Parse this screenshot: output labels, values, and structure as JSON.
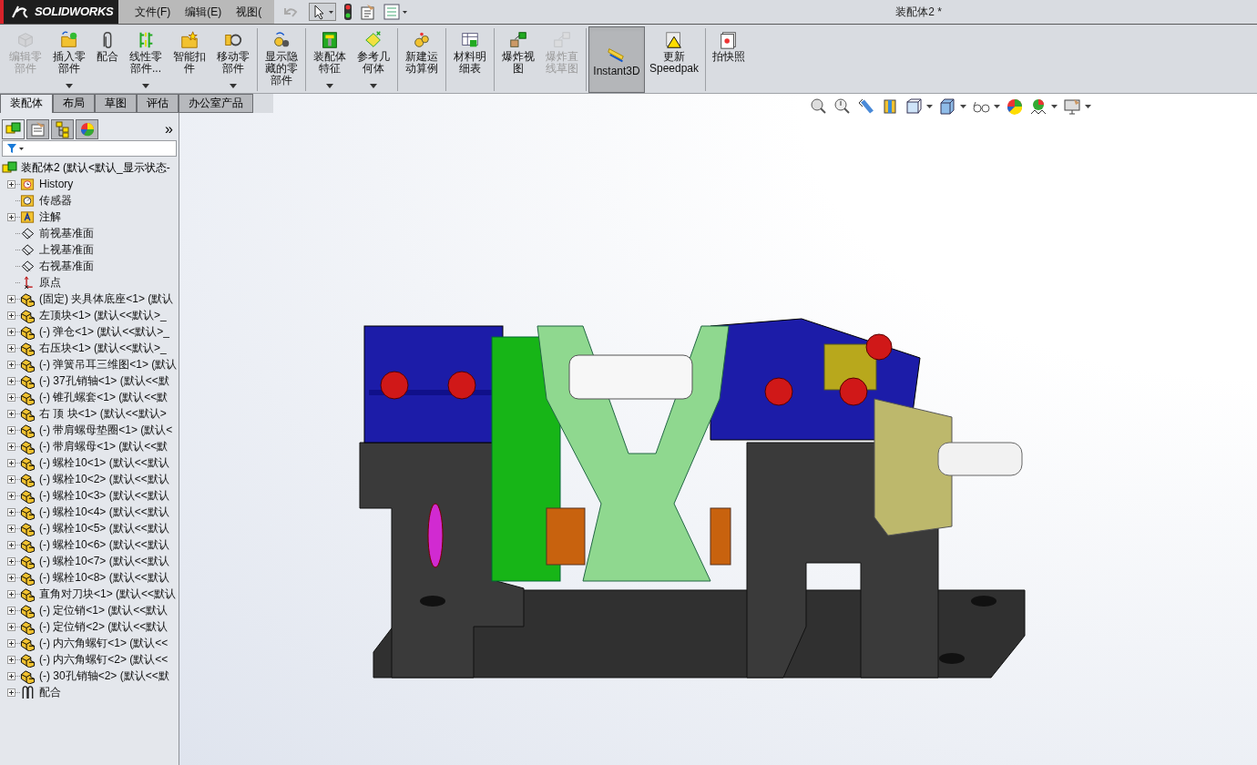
{
  "app": {
    "logo": "SOLIDWORKS"
  },
  "menu": [
    "文件(F)",
    "编辑(E)",
    "视图("
  ],
  "window": {
    "title": "装配体2 *"
  },
  "ribbon": [
    {
      "label": "编辑零部件",
      "disabled": true,
      "dropdown": false,
      "selected": false,
      "separator_after": false
    },
    {
      "label": "插入零部件",
      "disabled": false,
      "dropdown": true,
      "selected": false,
      "separator_after": false
    },
    {
      "label": "配合",
      "disabled": false,
      "dropdown": false,
      "selected": false,
      "separator_after": false
    },
    {
      "label": "线性零部件...",
      "disabled": false,
      "dropdown": true,
      "selected": false,
      "separator_after": false
    },
    {
      "label": "智能扣件",
      "disabled": false,
      "dropdown": false,
      "selected": false,
      "separator_after": false
    },
    {
      "label": "移动零部件",
      "disabled": false,
      "dropdown": true,
      "selected": false,
      "separator_after": true
    },
    {
      "label": "显示隐藏的零部件",
      "disabled": false,
      "dropdown": false,
      "selected": false,
      "separator_after": true
    },
    {
      "label": "装配体特征",
      "disabled": false,
      "dropdown": true,
      "selected": false,
      "separator_after": false
    },
    {
      "label": "参考几何体",
      "disabled": false,
      "dropdown": true,
      "selected": false,
      "separator_after": true
    },
    {
      "label": "新建运动算例",
      "disabled": false,
      "dropdown": false,
      "selected": false,
      "separator_after": true
    },
    {
      "label": "材料明细表",
      "disabled": false,
      "dropdown": false,
      "selected": false,
      "separator_after": true
    },
    {
      "label": "爆炸视图",
      "disabled": false,
      "dropdown": false,
      "selected": false,
      "separator_after": false
    },
    {
      "label": "爆炸直线草图",
      "disabled": true,
      "dropdown": false,
      "selected": false,
      "separator_after": true
    },
    {
      "label": "Instant3D",
      "disabled": false,
      "dropdown": false,
      "selected": true,
      "separator_after": false
    },
    {
      "label": "更新 Speedpak",
      "disabled": false,
      "dropdown": false,
      "selected": false,
      "separator_after": true
    },
    {
      "label": "拍快照",
      "disabled": false,
      "dropdown": false,
      "selected": false,
      "separator_after": false
    }
  ],
  "tabs": [
    {
      "label": "装配体",
      "selected": true
    },
    {
      "label": "布局",
      "selected": false
    },
    {
      "label": "草图",
      "selected": false
    },
    {
      "label": "评估",
      "selected": false
    },
    {
      "label": "办公室产品",
      "selected": false
    }
  ],
  "panel_tabs": [
    {
      "selected": true
    },
    {
      "selected": false
    },
    {
      "selected": false
    },
    {
      "selected": false
    }
  ],
  "panel_more": "»",
  "tree": {
    "root": "装配体2  (默认<默认_显示状态-",
    "items": [
      {
        "kind": "history",
        "label": "History",
        "expandable": true
      },
      {
        "kind": "sensor",
        "label": "传感器",
        "expandable": false
      },
      {
        "kind": "annotation",
        "label": "注解",
        "expandable": true
      },
      {
        "kind": "plane",
        "label": "前视基准面",
        "expandable": false
      },
      {
        "kind": "plane",
        "label": "上视基准面",
        "expandable": false
      },
      {
        "kind": "plane",
        "label": "右视基准面",
        "expandable": false
      },
      {
        "kind": "origin",
        "label": "原点",
        "expandable": false
      },
      {
        "kind": "part",
        "label": "(固定) 夹具体底座<1> (默认",
        "expandable": true
      },
      {
        "kind": "part",
        "label": "左顶块<1> (默认<<默认>_",
        "expandable": true
      },
      {
        "kind": "part",
        "label": "(-) 弹仓<1> (默认<<默认>_",
        "expandable": true
      },
      {
        "kind": "part",
        "label": "右压块<1> (默认<<默认>_",
        "expandable": true
      },
      {
        "kind": "part",
        "label": "(-) 弹簧吊耳三维图<1> (默认",
        "expandable": true
      },
      {
        "kind": "part",
        "label": "(-) 37孔销轴<1> (默认<<默",
        "expandable": true
      },
      {
        "kind": "part",
        "label": "(-) 锥孔螺套<1> (默认<<默",
        "expandable": true
      },
      {
        "kind": "part",
        "label": "右 顶 块<1> (默认<<默认>",
        "expandable": true
      },
      {
        "kind": "part",
        "label": "(-) 带肩螺母垫圈<1> (默认<",
        "expandable": true
      },
      {
        "kind": "part",
        "label": "(-) 带肩螺母<1> (默认<<默",
        "expandable": true
      },
      {
        "kind": "part",
        "label": "(-) 螺栓10<1> (默认<<默认",
        "expandable": true
      },
      {
        "kind": "part",
        "label": "(-) 螺栓10<2> (默认<<默认",
        "expandable": true
      },
      {
        "kind": "part",
        "label": "(-) 螺栓10<3> (默认<<默认",
        "expandable": true
      },
      {
        "kind": "part",
        "label": "(-) 螺栓10<4> (默认<<默认",
        "expandable": true
      },
      {
        "kind": "part",
        "label": "(-) 螺栓10<5> (默认<<默认",
        "expandable": true
      },
      {
        "kind": "part",
        "label": "(-) 螺栓10<6> (默认<<默认",
        "expandable": true
      },
      {
        "kind": "part",
        "label": "(-) 螺栓10<7> (默认<<默认",
        "expandable": true
      },
      {
        "kind": "part",
        "label": "(-) 螺栓10<8> (默认<<默认",
        "expandable": true
      },
      {
        "kind": "part",
        "label": "直角对刀块<1> (默认<<默认",
        "expandable": true
      },
      {
        "kind": "part",
        "label": "(-) 定位销<1> (默认<<默认",
        "expandable": true
      },
      {
        "kind": "part",
        "label": "(-) 定位销<2> (默认<<默认",
        "expandable": true
      },
      {
        "kind": "part",
        "label": "(-) 内六角螺钉<1> (默认<<",
        "expandable": true
      },
      {
        "kind": "part",
        "label": "(-) 内六角螺钉<2> (默认<<",
        "expandable": true
      },
      {
        "kind": "part",
        "label": "(-) 30孔销轴<2> (默认<<默",
        "expandable": true
      },
      {
        "kind": "mates",
        "label": "配合",
        "expandable": true
      }
    ]
  }
}
